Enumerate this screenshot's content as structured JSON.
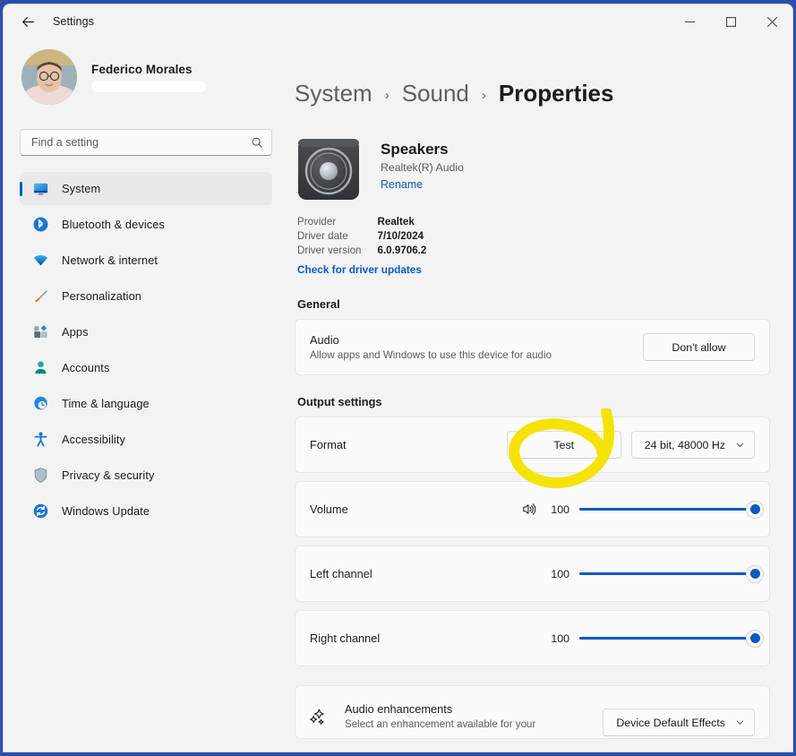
{
  "window": {
    "title": "Settings",
    "back_label": "Back",
    "minimize_label": "Minimize",
    "maximize_label": "Maximize",
    "close_label": "Close"
  },
  "account": {
    "name": "Federico Morales",
    "email_redacted": ""
  },
  "search": {
    "placeholder": "Find a setting",
    "value": ""
  },
  "sidebar": {
    "items": [
      {
        "label": "System",
        "icon": "monitor-icon",
        "selected": true
      },
      {
        "label": "Bluetooth & devices",
        "icon": "bluetooth-icon",
        "selected": false
      },
      {
        "label": "Network & internet",
        "icon": "wifi-icon",
        "selected": false
      },
      {
        "label": "Personalization",
        "icon": "paintbrush-icon",
        "selected": false
      },
      {
        "label": "Apps",
        "icon": "apps-icon",
        "selected": false
      },
      {
        "label": "Accounts",
        "icon": "person-icon",
        "selected": false
      },
      {
        "label": "Time & language",
        "icon": "clock-icon",
        "selected": false
      },
      {
        "label": "Accessibility",
        "icon": "accessibility-icon",
        "selected": false
      },
      {
        "label": "Privacy & security",
        "icon": "shield-icon",
        "selected": false
      },
      {
        "label": "Windows Update",
        "icon": "update-icon",
        "selected": false
      }
    ]
  },
  "breadcrumb": {
    "level1": "System",
    "level2": "Sound",
    "current": "Properties",
    "separator": "›"
  },
  "device": {
    "name": "Speakers",
    "subtitle": "Realtek(R) Audio",
    "rename_label": "Rename",
    "driver": {
      "rows": [
        {
          "key": "Provider",
          "value": "Realtek"
        },
        {
          "key": "Driver date",
          "value": "7/10/2024"
        },
        {
          "key": "Driver version",
          "value": "6.0.9706.2"
        }
      ],
      "update_link": "Check for driver updates"
    }
  },
  "general": {
    "section_title": "General",
    "audio": {
      "label": "Audio",
      "description": "Allow apps and Windows to use this device for audio",
      "button_label": "Don't allow"
    }
  },
  "output_settings": {
    "section_title": "Output settings",
    "format": {
      "label": "Format",
      "test_button_label": "Test",
      "selected_format": "24 bit, 48000 Hz"
    },
    "volume": {
      "label": "Volume",
      "value": "100",
      "percent": 100,
      "icon": "speaker-wave-icon"
    },
    "left_channel": {
      "label": "Left channel",
      "value": "100",
      "percent": 100
    },
    "right_channel": {
      "label": "Right channel",
      "value": "100",
      "percent": 100
    },
    "audio_enhancements": {
      "label": "Audio enhancements",
      "description": "Select an enhancement available for your",
      "selected_option": "Device Default Effects",
      "icon": "sparkles-icon"
    }
  },
  "annotation": {
    "type": "hand-drawn-ellipse",
    "color": "#F5E304",
    "target": "Test"
  },
  "colors": {
    "accent": "#0a5ac4",
    "link": "#0a5ac4",
    "window_bg": "#f3f3f3",
    "card_bg": "#fbfbfb",
    "desktop": "#2b4ea8",
    "highlight": "#F5E304"
  }
}
